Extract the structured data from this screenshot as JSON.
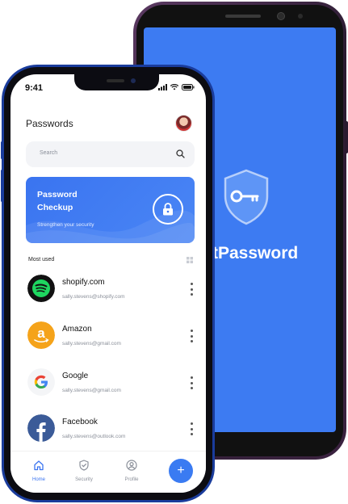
{
  "back_phone": {
    "brand_text": "tPassword"
  },
  "status_bar": {
    "time": "9:41"
  },
  "header": {
    "title": "Passwords"
  },
  "search": {
    "placeholder": "Search"
  },
  "checkup_card": {
    "title": "Password Checkup",
    "subtitle": "Strengthen your security"
  },
  "most_used": {
    "label": "Most used",
    "items": [
      {
        "name": "shopify.com",
        "email": "sally.stevens@shopify.com",
        "icon": "spotify-logo-icon"
      },
      {
        "name": "Amazon",
        "email": "sally.stevens@gmail.com",
        "icon": "amazon-logo-icon"
      },
      {
        "name": "Google",
        "email": "sally.stevens@gmail.com",
        "icon": "google-logo-icon"
      },
      {
        "name": "Facebook",
        "email": "sally.stevens@outlook.com",
        "icon": "facebook-logo-icon"
      }
    ]
  },
  "tabbar": {
    "home": "Home",
    "security": "Security",
    "profile": "Profile",
    "add": "+"
  },
  "colors": {
    "accent": "#3a74f0",
    "back_screen": "#3d7bf2",
    "front_frame": "#1a3c9c"
  }
}
